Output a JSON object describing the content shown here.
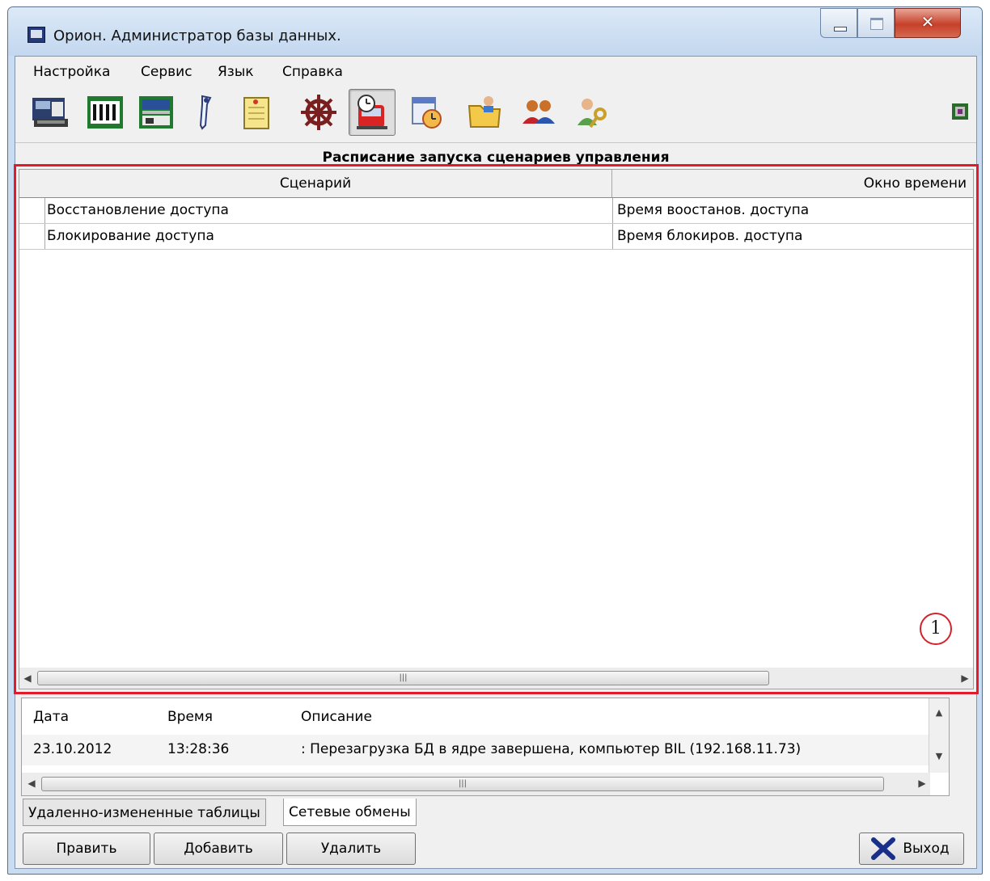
{
  "window": {
    "title": "Орион. Администратор базы данных."
  },
  "menu": [
    "Настройка",
    "Сервис",
    "Язык",
    "Справка"
  ],
  "toolbar": {
    "buttons": [
      {
        "icon": "keyboard-device-icon"
      },
      {
        "icon": "controller-board-icon"
      },
      {
        "icon": "device-panel-icon"
      },
      {
        "icon": "key-icon"
      },
      {
        "icon": "notepad-icon"
      },
      {
        "icon": "ship-wheel-icon"
      },
      {
        "icon": "schedule-train-icon",
        "active": true
      },
      {
        "icon": "calendar-clock-icon"
      },
      {
        "icon": "folder-user-icon"
      },
      {
        "icon": "user-group-icon"
      },
      {
        "icon": "user-key-icon"
      }
    ],
    "right_icon": "chip-icon"
  },
  "section_title": "Расписание запуска сценариев управления",
  "grid": {
    "columns": [
      "Сценарий",
      "Окно времени"
    ],
    "rows": [
      [
        "Восстановление доступа",
        "Время воостанов. доступа"
      ],
      [
        "Блокирование доступа",
        "Время блокиров. доступа"
      ]
    ]
  },
  "callout_label": "1",
  "log": {
    "columns": [
      "Дата",
      "Время",
      "Описание"
    ],
    "rows": [
      [
        "23.10.2012",
        "13:28:36",
        ": Перезагрузка БД в ядре завершена, компьютер BIL (192.168.11.73)"
      ]
    ]
  },
  "tabs": [
    "Удаленно-измененные таблицы",
    "Сетевые обмены"
  ],
  "buttons": {
    "edit": "Править",
    "add": "Добавить",
    "delete": "Удалить",
    "exit": "Выход"
  },
  "colors": {
    "highlight": "#e01b2a",
    "exit_icon": "#1a2f8a"
  }
}
